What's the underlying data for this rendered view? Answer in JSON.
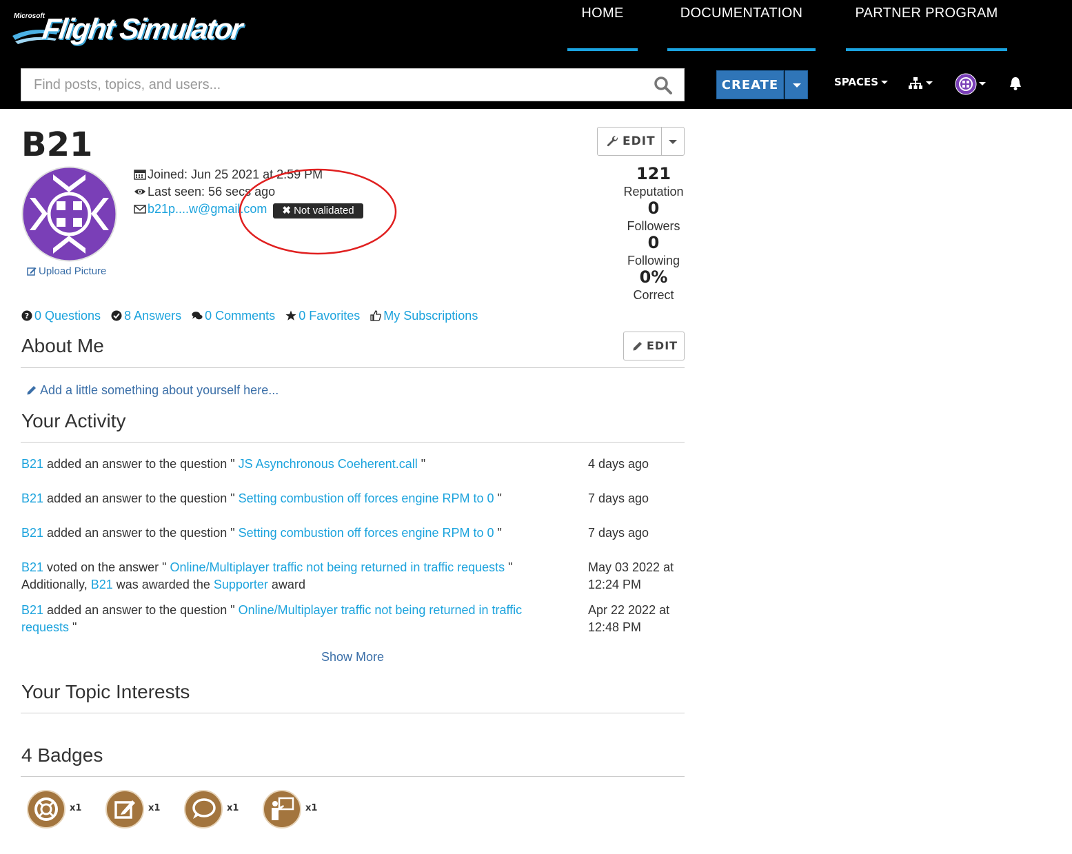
{
  "header": {
    "logo": {
      "brand_small": "Microsoft",
      "brand_main": "Flight Simulator"
    },
    "nav": [
      "HOME",
      "DOCUMENTATION",
      "PARTNER PROGRAM"
    ],
    "search": {
      "placeholder": "Find posts, topics, and users...",
      "value": ""
    },
    "create_label": "CREATE",
    "spaces_label": "SPACES",
    "icons": {
      "search": "search-icon",
      "sitemap": "sitemap-icon",
      "bell": "bell-icon"
    },
    "accent_color": "#1aa3e0",
    "create_color": "#2f75b8"
  },
  "profile": {
    "username": "B21",
    "edit_label": "EDIT",
    "upload_picture": "Upload Picture",
    "joined": "Joined: Jun 25 2021 at 2:59 PM",
    "last_seen": "Last seen: 56 secs ago",
    "email": "b21p....w@gmail.com",
    "email_status": "Not validated",
    "stats": [
      {
        "value": "121",
        "label": "Reputation"
      },
      {
        "value": "0",
        "label": "Followers"
      },
      {
        "value": "0",
        "label": "Following"
      },
      {
        "value": "0%",
        "label": "Correct"
      }
    ],
    "links": [
      "0 Questions",
      "8 Answers",
      "0 Comments",
      "0 Favorites",
      "My Subscriptions"
    ]
  },
  "about": {
    "title": "About Me",
    "edit_label": "EDIT",
    "placeholder": "Add a little something about yourself here..."
  },
  "activity": {
    "title": "Your Activity",
    "items": [
      {
        "user": "B21",
        "action": " added an answer to the question \" ",
        "link": "JS Asynchronous Coeherent.call",
        "end": " \"",
        "time": "4 days ago"
      },
      {
        "user": "B21",
        "action": " added an answer to the question \" ",
        "link": "Setting combustion off forces engine RPM to 0",
        "end": " \"",
        "time": "7 days ago"
      },
      {
        "user": "B21",
        "action": " added an answer to the question \" ",
        "link": "Setting combustion off forces engine RPM to 0",
        "end": " \"",
        "time": "7 days ago"
      },
      {
        "user": "B21",
        "action": " voted on the answer \" ",
        "link": "Online/Multiplayer traffic not being returned in traffic requests",
        "end": " \"",
        "extra_pre": "Additionally, ",
        "extra_user": "B21",
        "extra_mid": " was awarded the ",
        "extra_award": "Supporter",
        "extra_post": " award",
        "time": "May 03 2022 at 12:24 PM"
      },
      {
        "user": "B21",
        "action": " added an answer to the question \" ",
        "link": "Online/Multiplayer traffic not being returned in traffic requests",
        "end": " \"",
        "time": "Apr 22 2022 at 12:48 PM"
      }
    ],
    "show_more": "Show More"
  },
  "topics": {
    "title": "Your Topic Interests"
  },
  "badges": {
    "count": "4",
    "title": "Badges",
    "items": [
      {
        "icon": "lifebuoy-badge-icon",
        "count": "x1"
      },
      {
        "icon": "edit-badge-icon",
        "count": "x1"
      },
      {
        "icon": "comment-badge-icon",
        "count": "x1"
      },
      {
        "icon": "teacher-badge-icon",
        "count": "x1"
      }
    ],
    "badge_color": "#a3753e"
  },
  "annotation": {
    "color": "#e02020"
  }
}
